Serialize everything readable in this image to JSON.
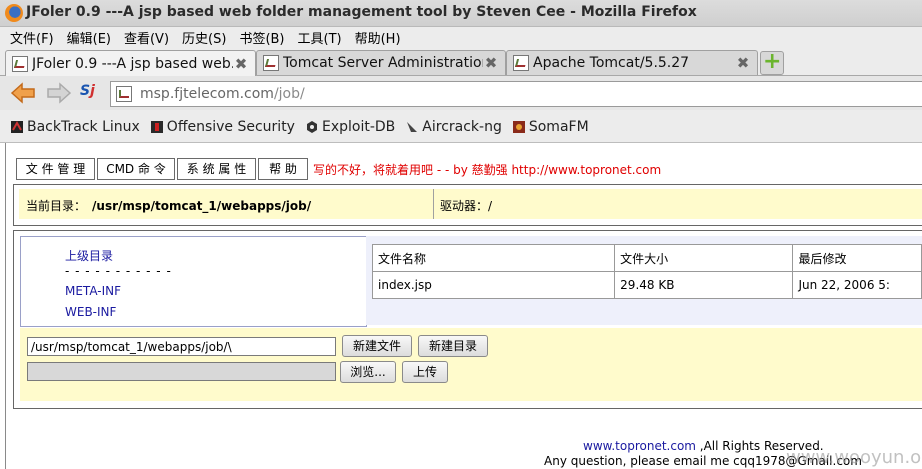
{
  "window": {
    "title": "JFoler 0.9 ---A jsp based web folder management tool by Steven Cee - Mozilla Firefox"
  },
  "menu": [
    "文件(F)",
    "编辑(E)",
    "查看(V)",
    "历史(S)",
    "书签(B)",
    "工具(T)",
    "帮助(H)"
  ],
  "tabs": [
    {
      "label": "JFoler 0.9 ---A jsp based web...",
      "active": true
    },
    {
      "label": "Tomcat Server Administration",
      "active": false
    },
    {
      "label": "Apache Tomcat/5.5.27",
      "active": false
    }
  ],
  "address": {
    "host": "msp.fjtelecom.com",
    "path": "/job/"
  },
  "bookmarks": [
    {
      "label": "BackTrack Linux",
      "icon": "backtrack-icon"
    },
    {
      "label": "Offensive Security",
      "icon": "offsec-icon"
    },
    {
      "label": "Exploit-DB",
      "icon": "exploitdb-icon"
    },
    {
      "label": "Aircrack-ng",
      "icon": "aircrack-icon"
    },
    {
      "label": "SomaFM",
      "icon": "somafm-icon"
    }
  ],
  "app": {
    "nav": [
      "文 件 管 理",
      "CMD 命 令",
      "系 统 属 性",
      "帮 助"
    ],
    "slogan": "写的不好，将就着用吧 - - by 慈勤强 http://www.topronet.com",
    "current_dir_label": "当前目录：",
    "current_dir": "/usr/msp/tomcat_1/webapps/job/",
    "drive_label": "驱动器：/",
    "parent_dir": "上级目录",
    "separator": "- - - - - - - - - - -",
    "dirs": [
      "META-INF",
      "WEB-INF"
    ],
    "table": {
      "headers": [
        "文件名称",
        "文件大小",
        "最后修改"
      ],
      "rows": [
        [
          "index.jsp",
          "29.48 KB",
          "Jun 22, 2006 5:"
        ]
      ]
    },
    "path_input": "/usr/msp/tomcat_1/webapps/job/\\",
    "new_file": "新建文件",
    "new_dir": "新建目录",
    "browse": "浏览...",
    "upload": "上传"
  },
  "footer": {
    "link": "www.topronet.com",
    "rights": " ,All Rights Reserved.",
    "contact": "Any question, please email me cqq1978@Gmail.com"
  },
  "watermark": "www.wooyun.org",
  "colors": {
    "slogan": "#e00000",
    "link": "#1a1aa0",
    "panel_bg": "#fffbcc"
  }
}
